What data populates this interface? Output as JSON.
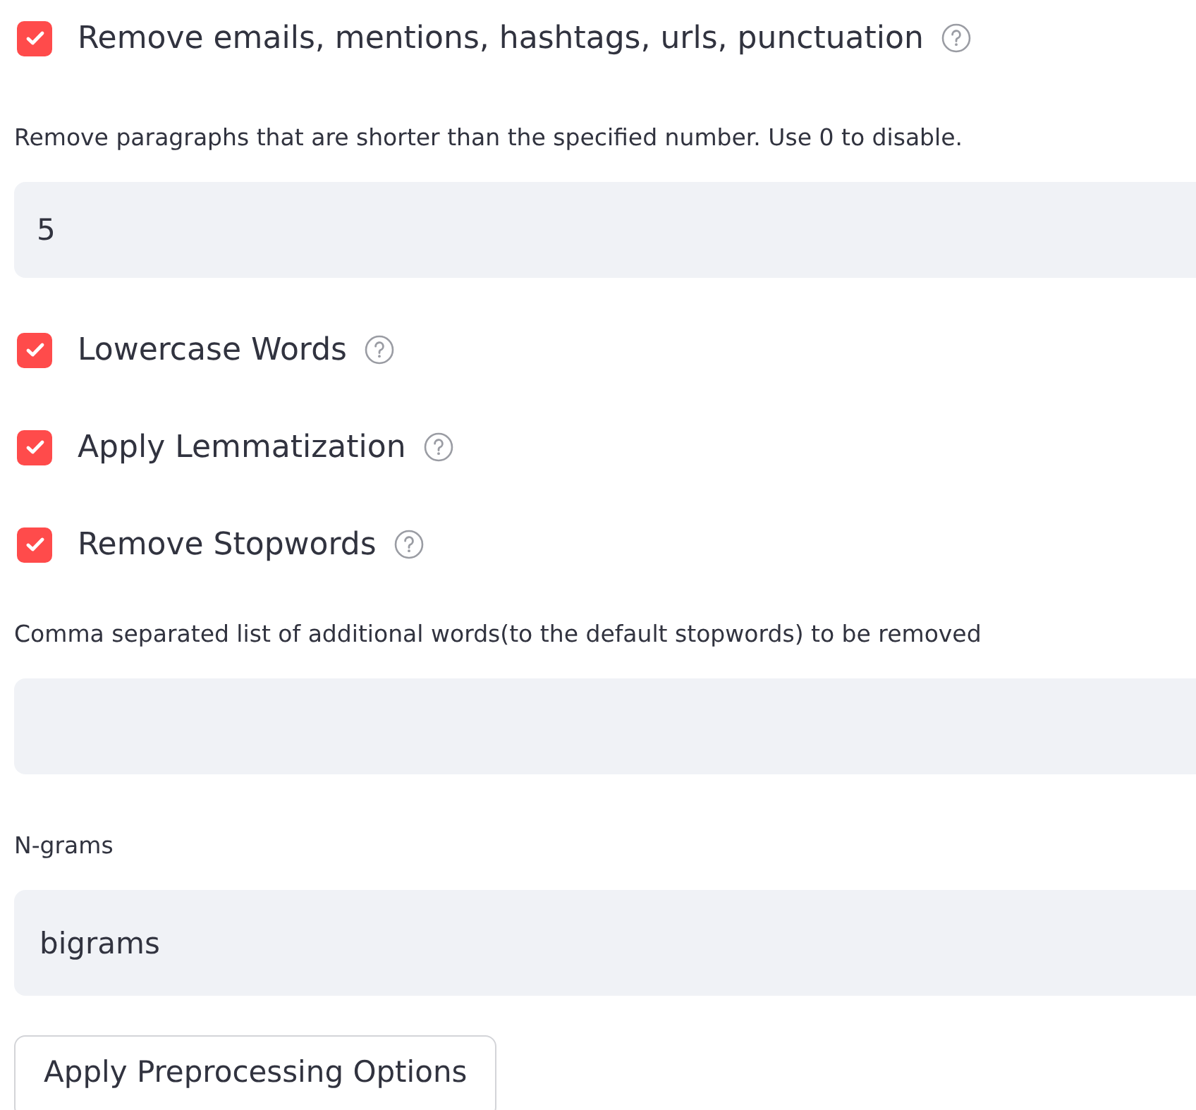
{
  "widgets": [
    {
      "kind": "checkbox",
      "label": "Remove emails, mentions, hashtags, urls, punctuation",
      "checked": true,
      "help": true
    },
    {
      "kind": "number",
      "label": "Remove paragraphs that are shorter than the specified number. Use 0 to disable.",
      "value": "5"
    },
    {
      "kind": "checkbox",
      "label": "Lowercase Words",
      "checked": true,
      "help": true
    },
    {
      "kind": "checkbox",
      "label": "Apply Lemmatization",
      "checked": true,
      "help": true
    },
    {
      "kind": "checkbox",
      "label": "Remove Stopwords",
      "checked": true,
      "help": true
    },
    {
      "kind": "text",
      "label": "Comma separated list of additional words(to the default stopwords) to be removed"
    },
    {
      "kind": "select",
      "label": "N-grams",
      "value": "bigrams"
    },
    {
      "kind": "button",
      "label": "Apply Preprocessing Options"
    }
  ]
}
